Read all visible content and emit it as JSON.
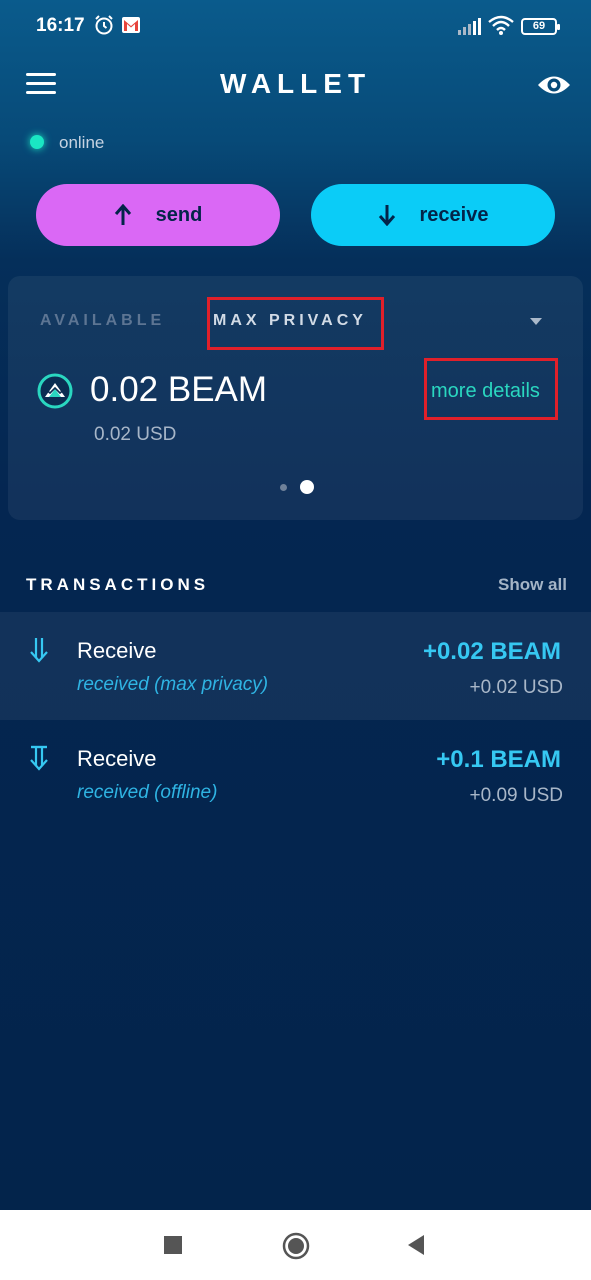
{
  "status_bar": {
    "time": "16:17",
    "battery": "69",
    "icons": [
      "alarm-icon",
      "gmail-icon",
      "signal-icon",
      "wifi-icon",
      "battery-icon"
    ]
  },
  "app_bar": {
    "title": "WALLET",
    "menu_icon": "hamburger-menu-icon",
    "visibility_icon": "eye-icon"
  },
  "connection": {
    "status": "online",
    "color": "#1ae6c3"
  },
  "actions": {
    "send_label": "send",
    "receive_label": "receive",
    "send_color": "#da68f5",
    "receive_color": "#0bccf7"
  },
  "balance_card": {
    "tabs": [
      {
        "label": "AVAILABLE",
        "active": false
      },
      {
        "label": "MAX PRIVACY",
        "active": true
      }
    ],
    "amount": "0.02 BEAM",
    "amount_usd": "0.02 USD",
    "more_details": "more details",
    "page_indicator": {
      "pages": 2,
      "current": 2
    }
  },
  "transactions": {
    "header": "TRANSACTIONS",
    "show_all": "Show all",
    "items": [
      {
        "title": "Receive",
        "subtitle": "received (max privacy)",
        "amount": "+0.02 BEAM",
        "usd": "+0.02 USD",
        "icon": "receive-arrow-icon"
      },
      {
        "title": "Receive",
        "subtitle": "received (offline)",
        "amount": "+0.1 BEAM",
        "usd": "+0.09 USD",
        "icon": "receive-offline-icon"
      }
    ]
  },
  "nav_bar": {
    "buttons": [
      "recent-apps-icon",
      "home-icon",
      "back-icon"
    ]
  },
  "colors": {
    "accent_teal": "#2ad7c0",
    "tx_blue": "#36c8f2",
    "annotation_red": "#e0202a"
  }
}
